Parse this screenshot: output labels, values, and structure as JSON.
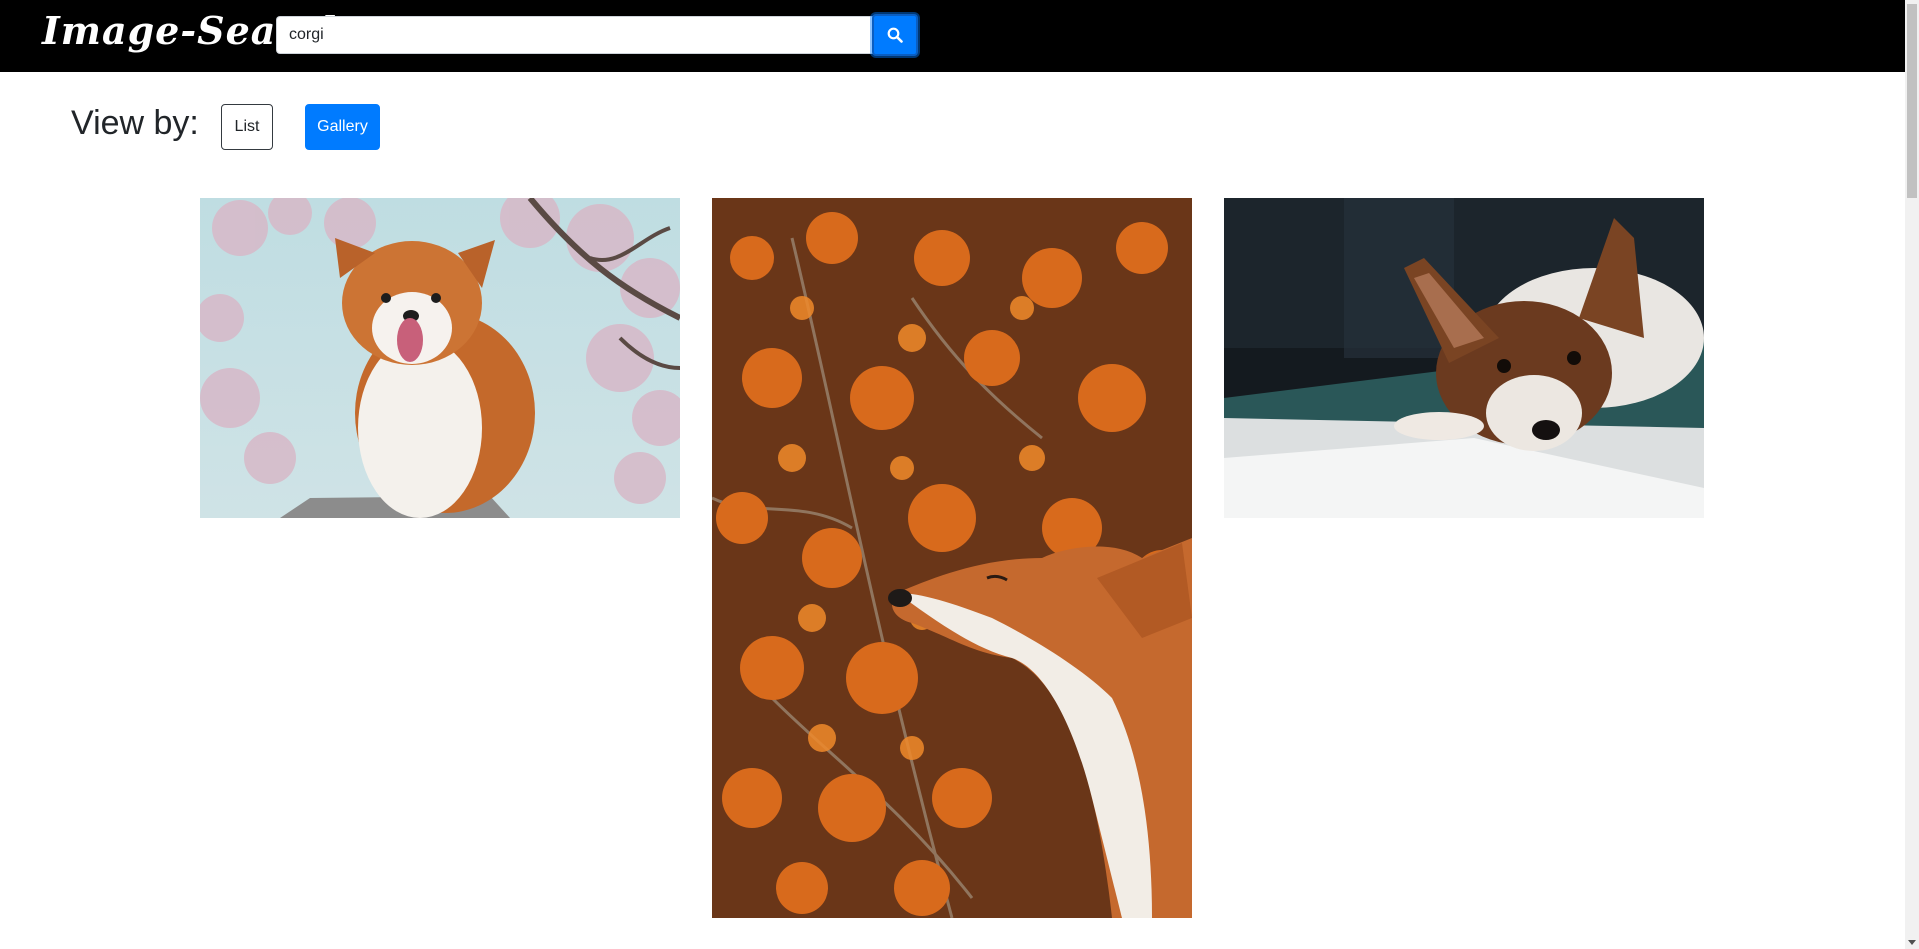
{
  "brand": {
    "logo_text": "Image-Search"
  },
  "search": {
    "value": "corgi",
    "button_icon": "search-icon"
  },
  "view": {
    "label": "View by:",
    "options": [
      {
        "label": "List",
        "active": false
      },
      {
        "label": "Gallery",
        "active": true
      }
    ]
  },
  "gallery": {
    "images": [
      {
        "subject": "corgi-cherry-blossoms"
      },
      {
        "subject": "corgi-orange-berries"
      },
      {
        "subject": "corgi-lying-in-sunlight"
      }
    ]
  },
  "colors": {
    "navbar": "#000000",
    "accent": "#007bff",
    "text": "#212529"
  }
}
